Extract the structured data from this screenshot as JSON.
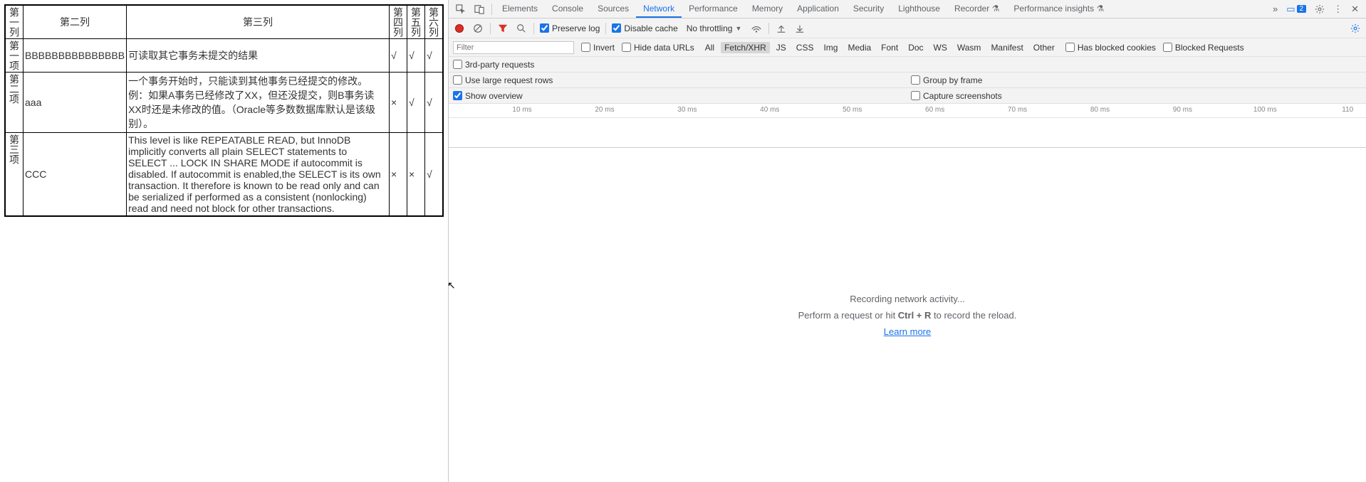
{
  "table": {
    "headers": [
      "第一列",
      "第二列",
      "第三列",
      "第四列",
      "第五列",
      "第六列"
    ],
    "rows": [
      {
        "c1": "第一项",
        "c2": "BBBBBBBBBBBBBBB",
        "c3": "可读取其它事务未提交的结果",
        "c4": "√",
        "c5": "√",
        "c6": "√"
      },
      {
        "c1": "第二项",
        "c2": "aaa",
        "c3": "一个事务开始时，只能读到其他事务已经提交的修改。 例：如果A事务已经修改了XX，但还没提交，则B事务读XX时还是未修改的值。（Oracle等多数数据库默认是该级别）。",
        "c4": "×",
        "c5": "√",
        "c6": "√"
      },
      {
        "c1": "第三项",
        "c2": "CCC",
        "c3": "This level is like REPEATABLE READ, but InnoDB implicitly converts all plain SELECT statements to SELECT ... LOCK IN SHARE MODE if autocommit is disabled. If autocommit is enabled,the SELECT is its own transaction. It therefore is known to be read only and can be serialized if performed as a consistent (nonlocking) read and need not block for other transactions.",
        "c4": "×",
        "c5": "×",
        "c6": "√"
      }
    ]
  },
  "devtools": {
    "tabs": [
      "Elements",
      "Console",
      "Sources",
      "Network",
      "Performance",
      "Memory",
      "Application",
      "Security",
      "Lighthouse",
      "Recorder ⚗",
      "Performance insights ⚗"
    ],
    "activeTab": "Network",
    "badge": "2",
    "row1": {
      "preserve_log": "Preserve log",
      "disable_cache": "Disable cache",
      "throttling": "No throttling"
    },
    "filter": {
      "placeholder": "Filter",
      "invert": "Invert",
      "hide_data": "Hide data URLs",
      "types": [
        "All",
        "Fetch/XHR",
        "JS",
        "CSS",
        "Img",
        "Media",
        "Font",
        "Doc",
        "WS",
        "Wasm",
        "Manifest",
        "Other"
      ],
      "activeType": "Fetch/XHR",
      "blocked_cookies": "Has blocked cookies",
      "blocked_requests": "Blocked Requests",
      "third_party": "3rd-party requests"
    },
    "opts": {
      "large_rows": "Use large request rows",
      "group_frame": "Group by frame",
      "show_overview": "Show overview",
      "capture": "Capture screenshots"
    },
    "timeline_ticks": [
      "10 ms",
      "20 ms",
      "30 ms",
      "40 ms",
      "50 ms",
      "60 ms",
      "70 ms",
      "80 ms",
      "90 ms",
      "100 ms",
      "110"
    ],
    "empty": {
      "line1": "Recording network activity...",
      "line2a": "Perform a request or hit ",
      "line2b": "Ctrl + R",
      "line2c": " to record the reload.",
      "link": "Learn more"
    }
  }
}
